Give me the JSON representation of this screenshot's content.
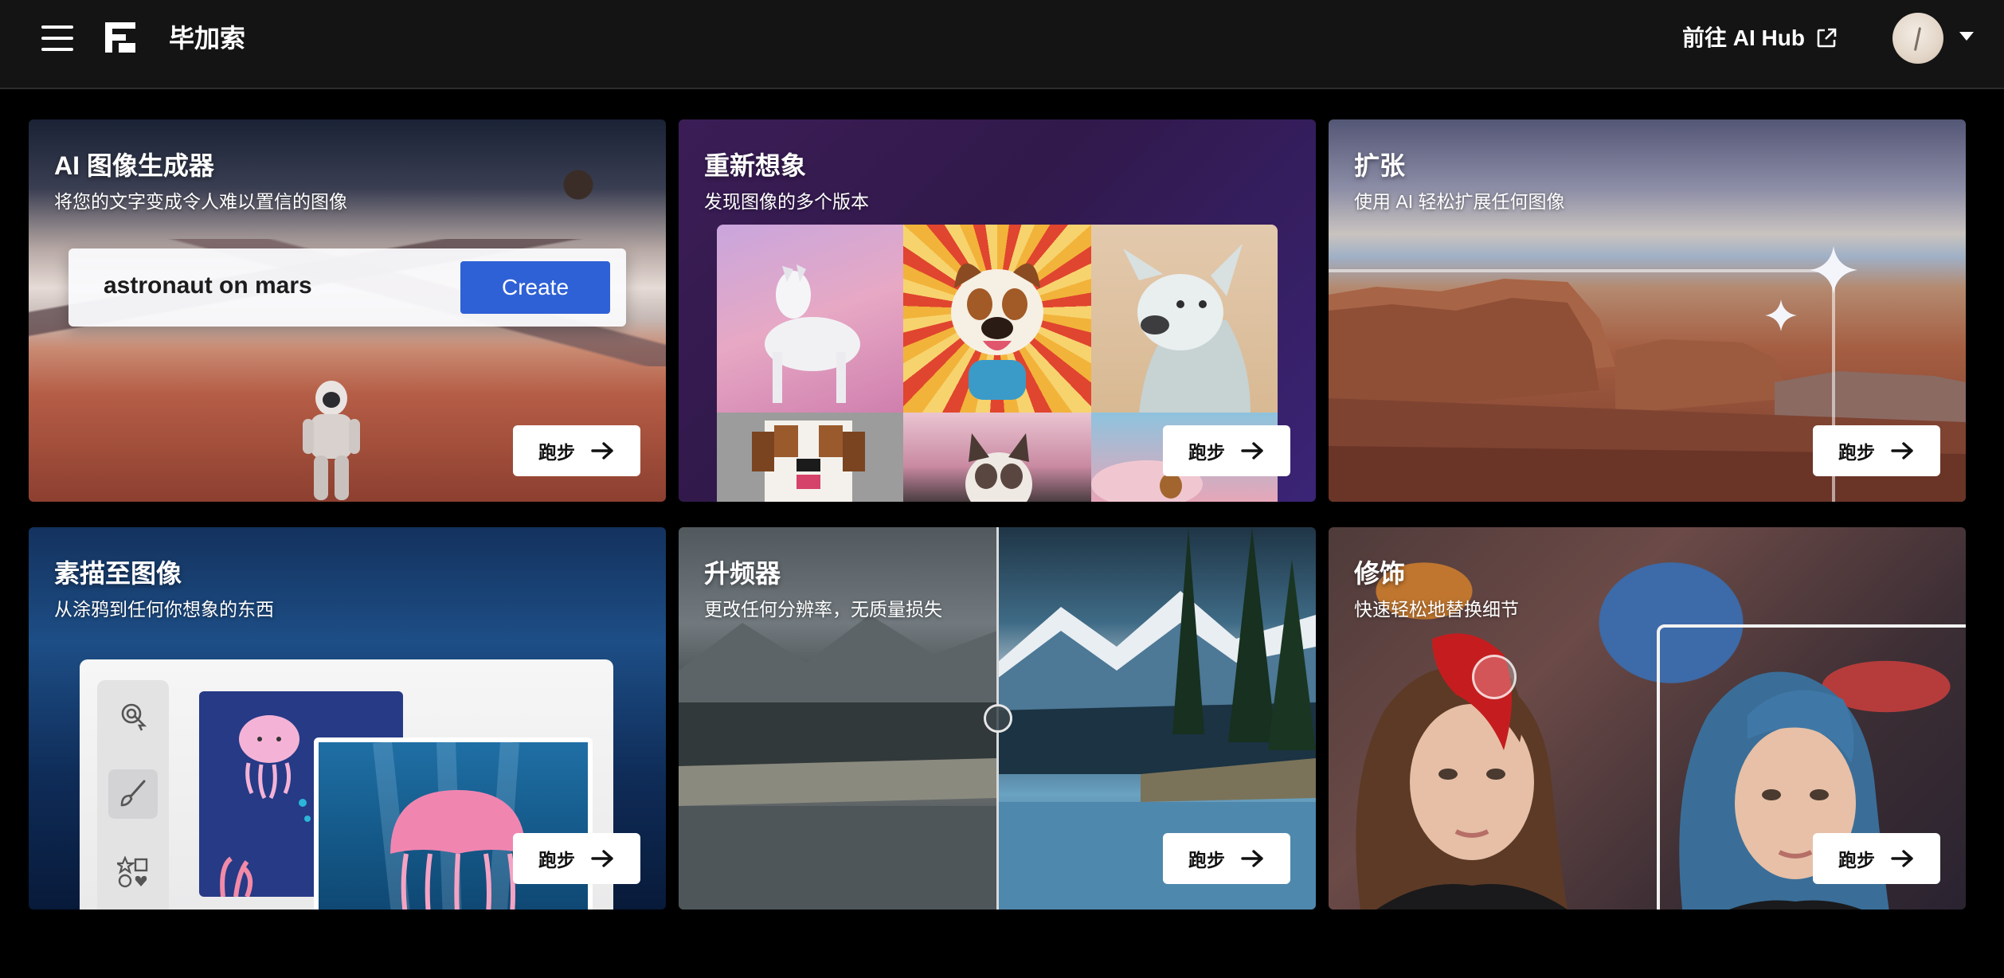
{
  "header": {
    "brand": "毕加索",
    "hub_link": "前往 AI Hub",
    "menu_icon": "hamburger-menu-icon",
    "external_icon": "external-link-icon"
  },
  "cards": [
    {
      "title": "AI 图像生成器",
      "subtitle": "将您的文字变成令人难以置信的图像",
      "prompt_value": "astronaut on mars",
      "create_label": "Create",
      "run_label": "跑步"
    },
    {
      "title": "重新想象",
      "subtitle": "发现图像的多个版本",
      "run_label": "跑步"
    },
    {
      "title": "扩张",
      "subtitle": "使用 AI 轻松扩展任何图像",
      "run_label": "跑步"
    },
    {
      "title": "素描至图像",
      "subtitle": "从涂鸦到任何你想象的东西",
      "run_label": "跑步"
    },
    {
      "title": "升频器",
      "subtitle": "更改任何分辨率，无质量损失",
      "run_label": "跑步"
    },
    {
      "title": "修饰",
      "subtitle": "快速轻松地替换细节",
      "run_label": "跑步"
    }
  ],
  "colors": {
    "header_bg": "#141414",
    "page_bg": "#000000",
    "create_button": "#2f61d6",
    "run_button_bg": "#ffffff"
  }
}
